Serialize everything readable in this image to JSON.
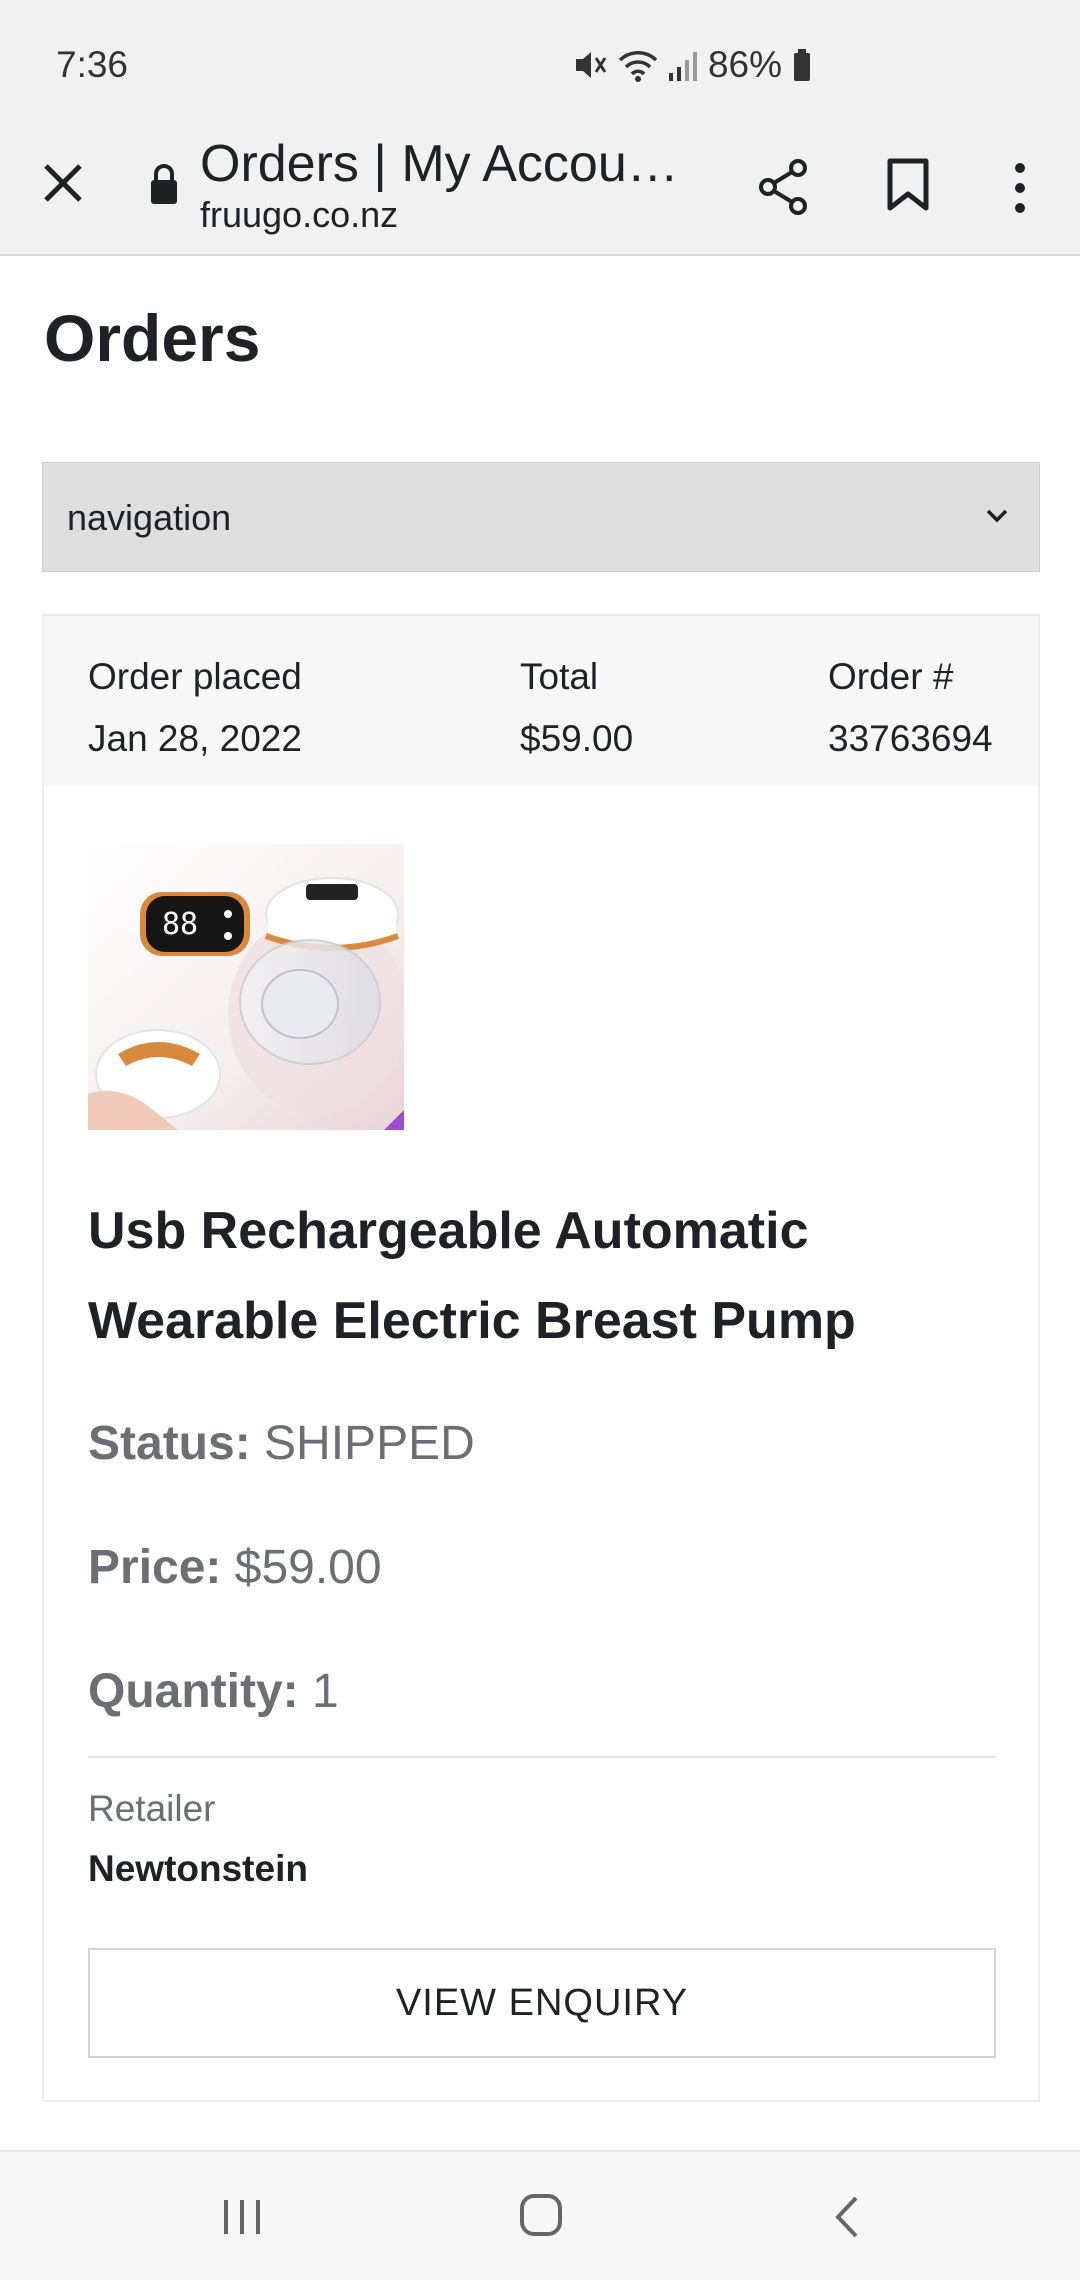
{
  "status_bar": {
    "time": "7:36",
    "battery": "86%"
  },
  "browser": {
    "title": "Orders | My Accou…",
    "url": "fruugo.co.nz"
  },
  "page": {
    "title": "Orders",
    "navigation_select": {
      "selected": "navigation"
    }
  },
  "order": {
    "placed_label": "Order placed",
    "placed_value": "Jan 28, 2022",
    "total_label": "Total",
    "total_value": "$59.00",
    "number_label": "Order #",
    "number_value": "33763694",
    "product": {
      "title": "Usb Rechargeable Automatic Wearable Electric Breast Pump",
      "status_label": "Status:",
      "status_value": "SHIPPED",
      "price_label": "Price:",
      "price_value": "$59.00",
      "quantity_label": "Quantity:",
      "quantity_value": "1",
      "display_digits": "88"
    },
    "retailer_label": "Retailer",
    "retailer_name": "Newtonstein",
    "enquiry_button": "VIEW ENQUIRY"
  },
  "colors": {
    "chrome_bg": "#f1f1f1",
    "select_bg": "#dedede",
    "header_bg": "#f7f7f8",
    "text_dark": "#1f2126",
    "text_muted": "#6b6e73",
    "accent_orange": "#d9893e"
  }
}
